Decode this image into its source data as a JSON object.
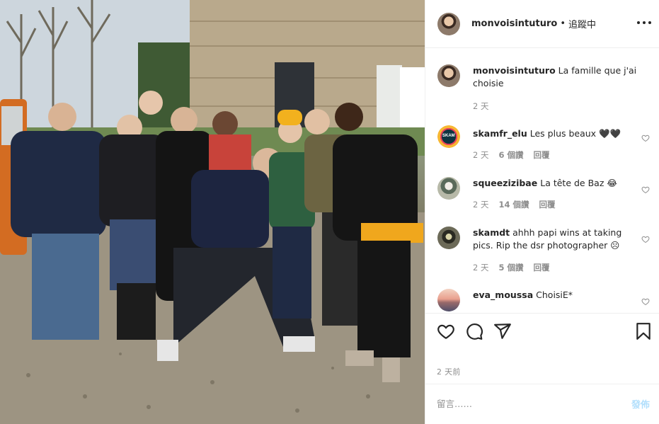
{
  "post": {
    "username": "monvoisintuturo",
    "separator": "•",
    "follow_label": "追蹤中",
    "time_ago": "2 天前"
  },
  "caption": {
    "username": "monvoisintuturo",
    "text": "La famille que j'ai choisie",
    "time": "2 天"
  },
  "comments": [
    {
      "username": "skamfr_elu",
      "text": "Les plus beaux 🖤🖤",
      "time": "2 天",
      "likes": "6 個讚",
      "reply": "回覆",
      "avatar_text": "SKAM"
    },
    {
      "username": "squeezizibae",
      "text": "La tête de Baz 😂",
      "time": "2 天",
      "likes": "14 個讚",
      "reply": "回覆"
    },
    {
      "username": "skamdt",
      "text": "ahhh papi wins at taking pics. Rip the dsr photographer ☹",
      "time": "2 天",
      "likes": "5 個讚",
      "reply": "回覆"
    },
    {
      "username": "eva_moussa",
      "text": "ChoisiE*"
    }
  ],
  "comment_box": {
    "placeholder": "留言……",
    "post_label": "發佈"
  },
  "icons": {
    "like": "heart-icon",
    "comment": "comment-icon",
    "share": "share-icon",
    "save": "bookmark-icon",
    "more": "more-options-icon"
  },
  "colors": {
    "text": "#262626",
    "secondary": "#8e8e8e",
    "border": "#efefef",
    "post_disabled": "#b2dffc"
  }
}
